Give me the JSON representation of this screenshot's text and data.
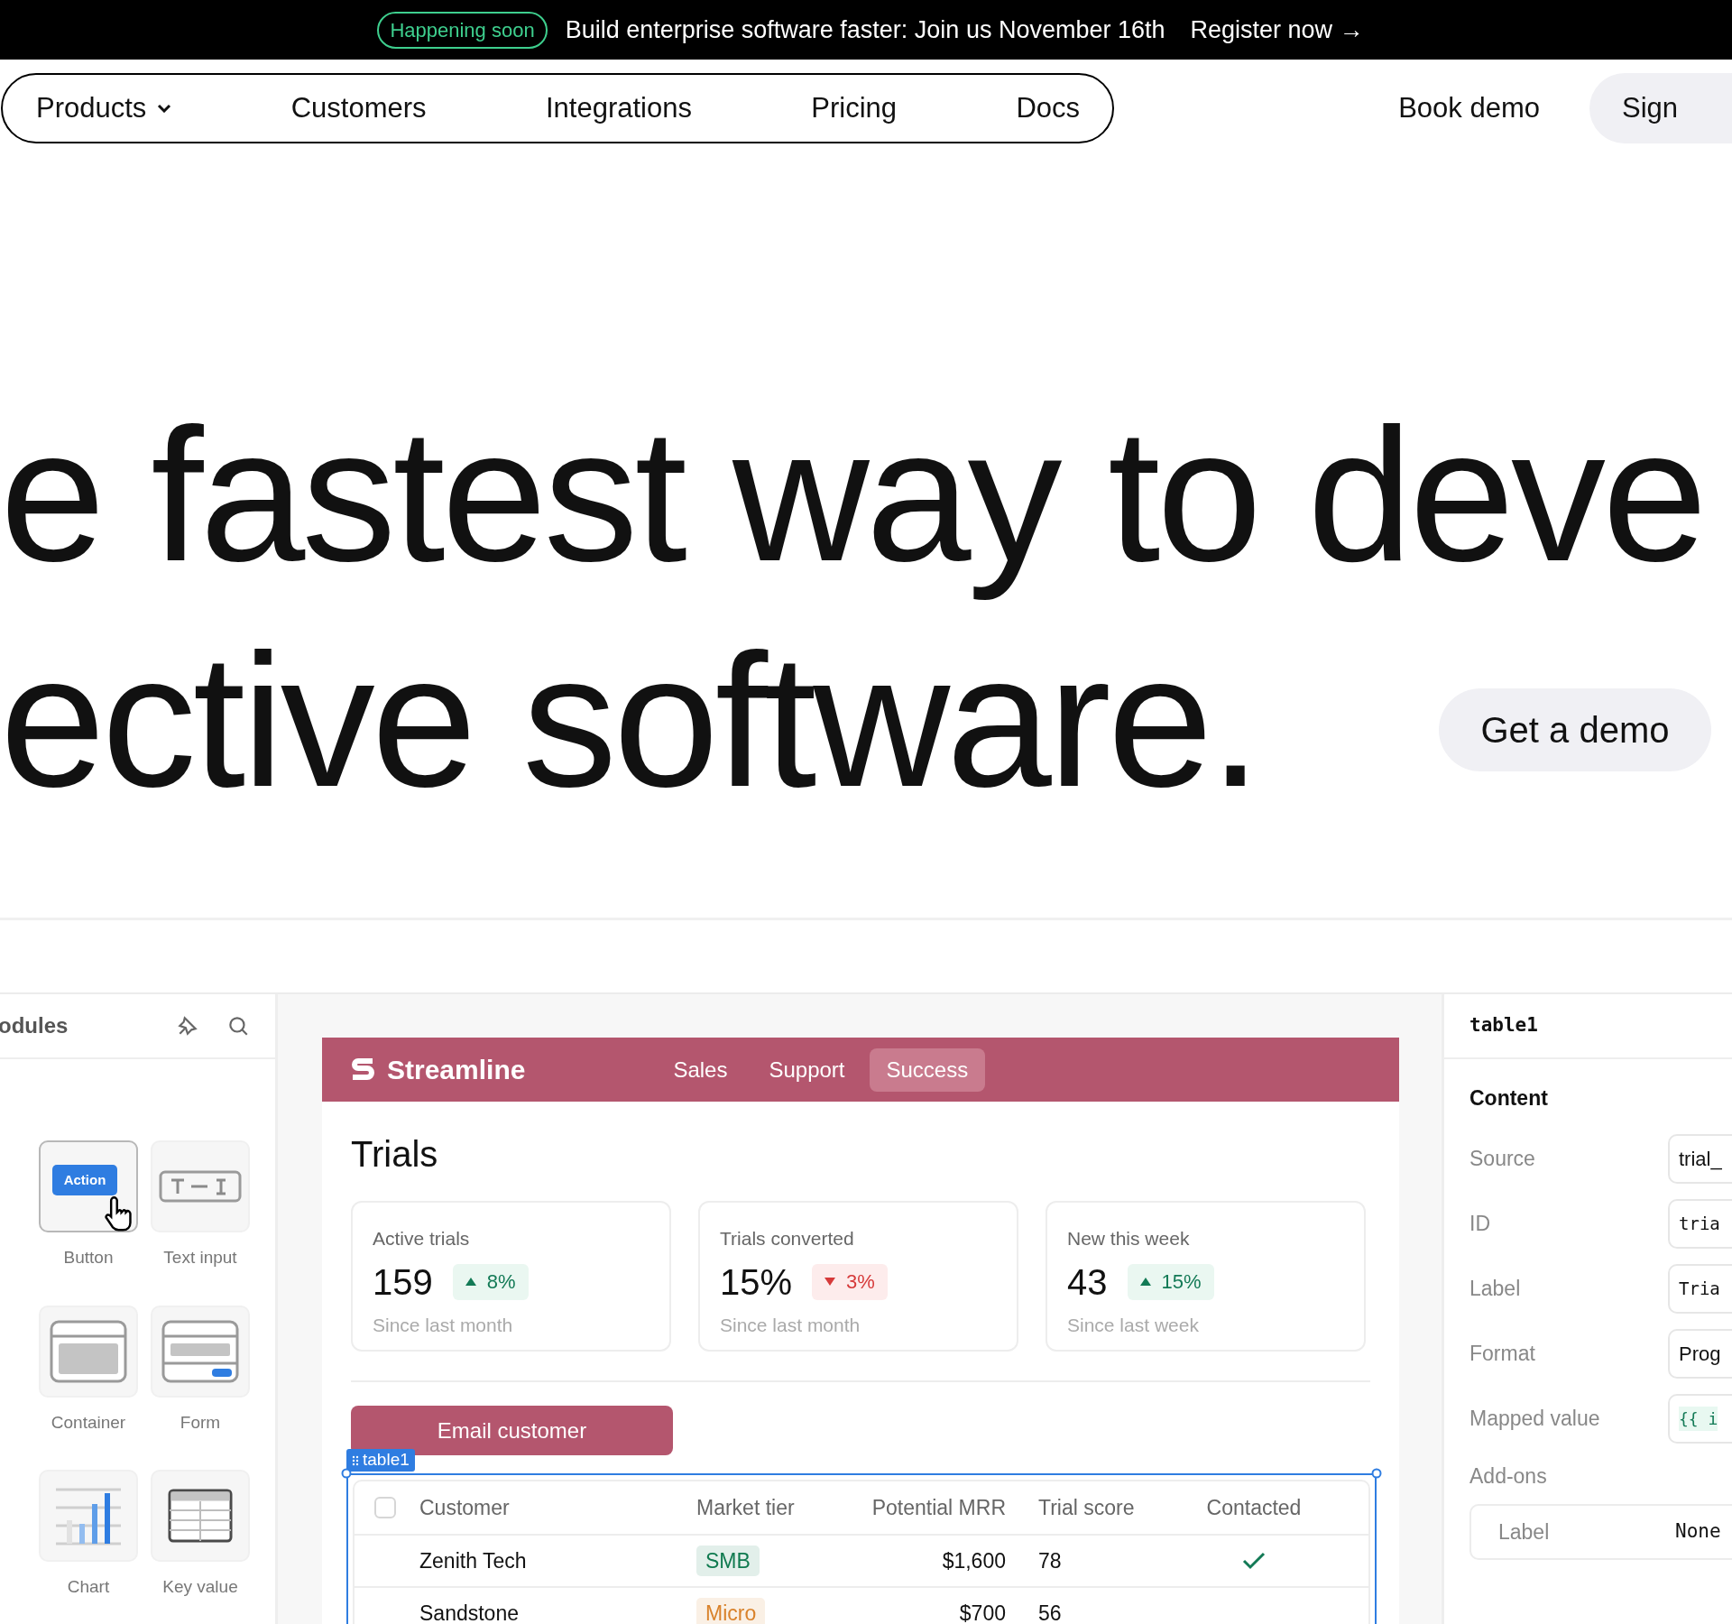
{
  "banner": {
    "badge": "Happening soon",
    "text": "Build enterprise software faster: Join us November 16th",
    "link": "Register now →"
  },
  "nav": {
    "items": [
      {
        "label": "Products",
        "has_menu": true
      },
      {
        "label": "Customers",
        "has_menu": false
      },
      {
        "label": "Integrations",
        "has_menu": false
      },
      {
        "label": "Pricing",
        "has_menu": false
      },
      {
        "label": "Docs",
        "has_menu": false
      }
    ],
    "book_demo": "Book demo",
    "sign": "Sign"
  },
  "hero": {
    "lines": [
      "e fastest way to deve",
      "ective software."
    ],
    "cta": "Get a demo"
  },
  "modules_panel": {
    "title": "odules",
    "modules": [
      {
        "label": "Button",
        "kind": "button",
        "hovered": true,
        "preview_text": "Action"
      },
      {
        "label": "Text input",
        "kind": "text_input",
        "hovered": false
      },
      {
        "label": "Container",
        "kind": "container",
        "hovered": false
      },
      {
        "label": "Form",
        "kind": "form",
        "hovered": false
      },
      {
        "label": "Chart",
        "kind": "chart",
        "hovered": false
      },
      {
        "label": "Key value",
        "kind": "key_value",
        "hovered": false
      }
    ]
  },
  "app": {
    "brand": "Streamline",
    "tabs": [
      {
        "label": "Sales",
        "selected": false
      },
      {
        "label": "Support",
        "selected": false
      },
      {
        "label": "Success",
        "selected": true
      }
    ],
    "title": "Trials",
    "stats": [
      {
        "label": "Active trials",
        "value": "159",
        "change": "8%",
        "kind": "up",
        "caption": "Since last month"
      },
      {
        "label": "Trials converted",
        "value": "15%",
        "change": "3%",
        "kind": "down",
        "caption": "Since last month"
      },
      {
        "label": "New this week",
        "value": "43",
        "change": "15%",
        "kind": "up",
        "caption": "Since last week"
      }
    ],
    "action_button": "Email customer",
    "table": {
      "tag": "table1",
      "select_all_checked": false,
      "columns": [
        "Customer",
        "Market tier",
        "Potential MRR",
        "Trial score",
        "Contacted"
      ],
      "rows": [
        {
          "customer": "Zenith Tech",
          "tier": "SMB",
          "color": "#0f7a4f",
          "mrr": "$1,600",
          "score": "78",
          "contacted": true
        },
        {
          "customer": "Sandstone",
          "tier": "Micro",
          "color": "#d9822b",
          "mrr": "$700",
          "score": "56",
          "contacted": false
        }
      ]
    }
  },
  "inspector": {
    "title": "table1",
    "section": "Content",
    "fields": [
      {
        "label": "Source",
        "value": "trial_",
        "kind": "text"
      },
      {
        "label": "ID",
        "value": "tria",
        "kind": "mono"
      },
      {
        "label": "Label",
        "value": "Tria",
        "kind": "mono"
      },
      {
        "label": "Format",
        "value": "Prog",
        "kind": "text"
      },
      {
        "label": "Mapped value",
        "value": "{{ i",
        "kind": "code"
      }
    ],
    "addons_label": "Add-ons",
    "addon": {
      "label": "Label",
      "value": "None"
    }
  }
}
